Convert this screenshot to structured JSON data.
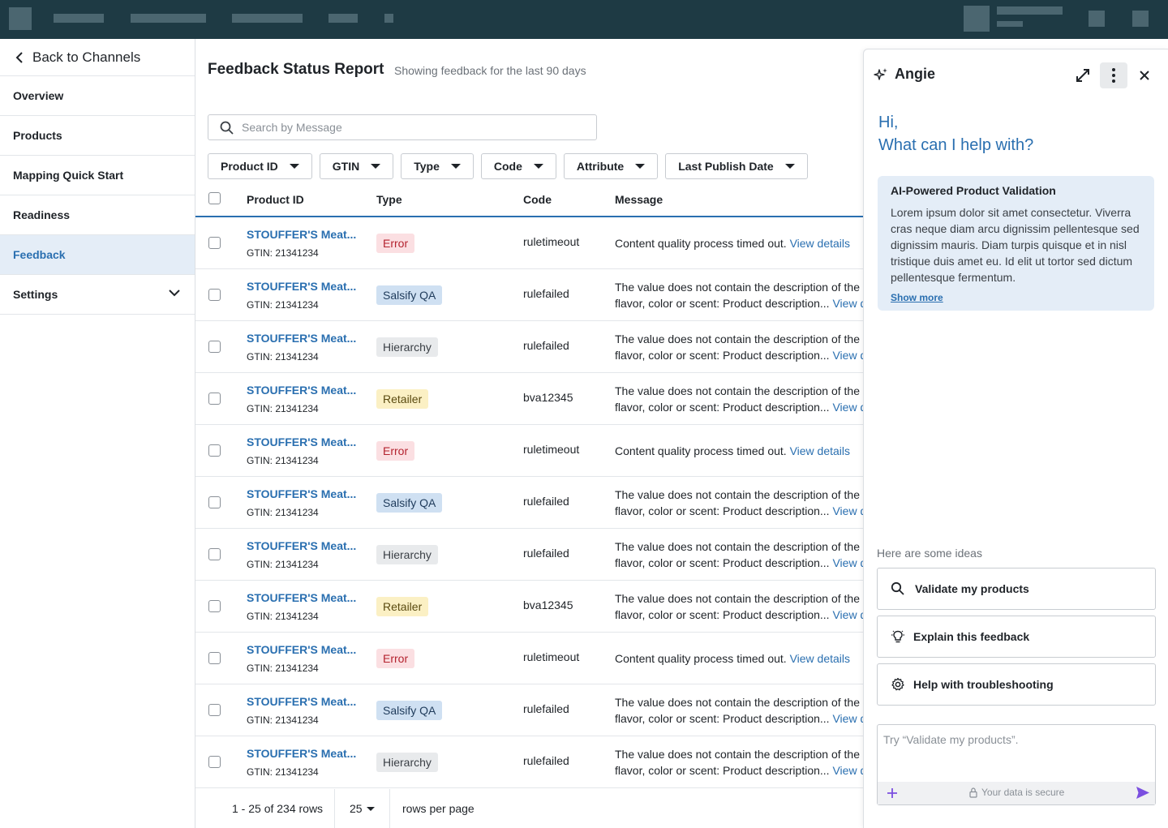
{
  "sidebar": {
    "back_label": "Back to Channels",
    "items": [
      {
        "label": "Overview"
      },
      {
        "label": "Products"
      },
      {
        "label": "Mapping Quick Start"
      },
      {
        "label": "Readiness"
      },
      {
        "label": "Feedback",
        "active": true
      },
      {
        "label": "Settings",
        "expandable": true
      }
    ]
  },
  "main": {
    "title": "Feedback Status Report",
    "subtitle": "Showing feedback for the last 90 days",
    "search_placeholder": "Search by Message",
    "filters": [
      "Product ID",
      "GTIN",
      "Type",
      "Code",
      "Attribute",
      "Last Publish Date"
    ],
    "columns": {
      "product_id": "Product ID",
      "type": "Type",
      "code": "Code",
      "message": "Message"
    },
    "rows": [
      {
        "name": "STOUFFER'S Meat...",
        "gtin": "GTIN: 21341234",
        "type": "Error",
        "badge": "Error",
        "code": "ruletimeout",
        "msg1": "Content quality process timed out.",
        "msg2": "",
        "link": "View details"
      },
      {
        "name": "STOUFFER'S Meat...",
        "gtin": "GTIN: 21341234",
        "type": "Salsify QA",
        "badge": "SalsifyQA",
        "code": "rulefailed",
        "msg1": "The value does not contain the description of the p",
        "msg2": "flavor, color or scent: Product description...",
        "link": "View d"
      },
      {
        "name": "STOUFFER'S Meat...",
        "gtin": "GTIN: 21341234",
        "type": "Hierarchy",
        "badge": "Hierarchy",
        "code": "rulefailed",
        "msg1": "The value does not contain the description of the p",
        "msg2": "flavor, color or scent: Product description...",
        "link": "View d"
      },
      {
        "name": "STOUFFER'S Meat...",
        "gtin": "GTIN: 21341234",
        "type": "Retailer",
        "badge": "Retailer",
        "code": "bva12345",
        "msg1": "The value does not contain the description of the p",
        "msg2": "flavor, color or scent: Product description...",
        "link": "View d"
      },
      {
        "name": "STOUFFER'S Meat...",
        "gtin": "GTIN: 21341234",
        "type": "Error",
        "badge": "Error",
        "code": "ruletimeout",
        "msg1": "Content quality process timed out.",
        "msg2": "",
        "link": "View details"
      },
      {
        "name": "STOUFFER'S Meat...",
        "gtin": "GTIN: 21341234",
        "type": "Salsify QA",
        "badge": "SalsifyQA",
        "code": "rulefailed",
        "msg1": "The value does not contain the description of the p",
        "msg2": "flavor, color or scent: Product description...",
        "link": "View d"
      },
      {
        "name": "STOUFFER'S Meat...",
        "gtin": "GTIN: 21341234",
        "type": "Hierarchy",
        "badge": "Hierarchy",
        "code": "rulefailed",
        "msg1": "The value does not contain the description of the p",
        "msg2": "flavor, color or scent: Product description...",
        "link": "View d"
      },
      {
        "name": "STOUFFER'S Meat...",
        "gtin": "GTIN: 21341234",
        "type": "Retailer",
        "badge": "Retailer",
        "code": "bva12345",
        "msg1": "The value does not contain the description of the p",
        "msg2": "flavor, color or scent: Product description...",
        "link": "View d"
      },
      {
        "name": "STOUFFER'S Meat...",
        "gtin": "GTIN: 21341234",
        "type": "Error",
        "badge": "Error",
        "code": "ruletimeout",
        "msg1": "Content quality process timed out.",
        "msg2": "",
        "link": "View details"
      },
      {
        "name": "STOUFFER'S Meat...",
        "gtin": "GTIN: 21341234",
        "type": "Salsify QA",
        "badge": "SalsifyQA",
        "code": "rulefailed",
        "msg1": "The value does not contain the description of the p",
        "msg2": "flavor, color or scent: Product description...",
        "link": "View d"
      },
      {
        "name": "STOUFFER'S Meat...",
        "gtin": "GTIN: 21341234",
        "type": "Hierarchy",
        "badge": "Hierarchy",
        "code": "rulefailed",
        "msg1": "The value does not contain the description of the p",
        "msg2": "flavor, color or scent: Product description...",
        "link": "View d"
      }
    ],
    "footer": {
      "range": "1 - 25 of 234 rows",
      "per_page": "25",
      "per_page_label": "rows per page"
    }
  },
  "panel": {
    "title": "Angie",
    "greeting_1": "Hi,",
    "greeting_2": "What can I help with?",
    "card_title": "AI-Powered Product Validation",
    "card_text": "Lorem ipsum dolor sit amet consectetur. Viverra cras neque diam arcu dignissim pellentesque sed dignissim mauris. Diam turpis quisque et in nisl tristique duis amet eu. Id elit ut tortor sed dictum pellentesque fermentum.",
    "card_more": "Show more",
    "ideas_title": "Here are some ideas",
    "ideas": [
      {
        "label": "Validate my products",
        "icon": "search-icon"
      },
      {
        "label": "Explain this feedback",
        "icon": "lightbulb-icon"
      },
      {
        "label": "Help with troubleshooting",
        "icon": "gear-icon"
      }
    ],
    "input_placeholder": "Try “Validate my products”.",
    "secure_text": "Your data is secure"
  },
  "colors": {
    "topbar": "#1e3a44",
    "accent": "#2a6fb0",
    "send": "#7b4fe0"
  }
}
